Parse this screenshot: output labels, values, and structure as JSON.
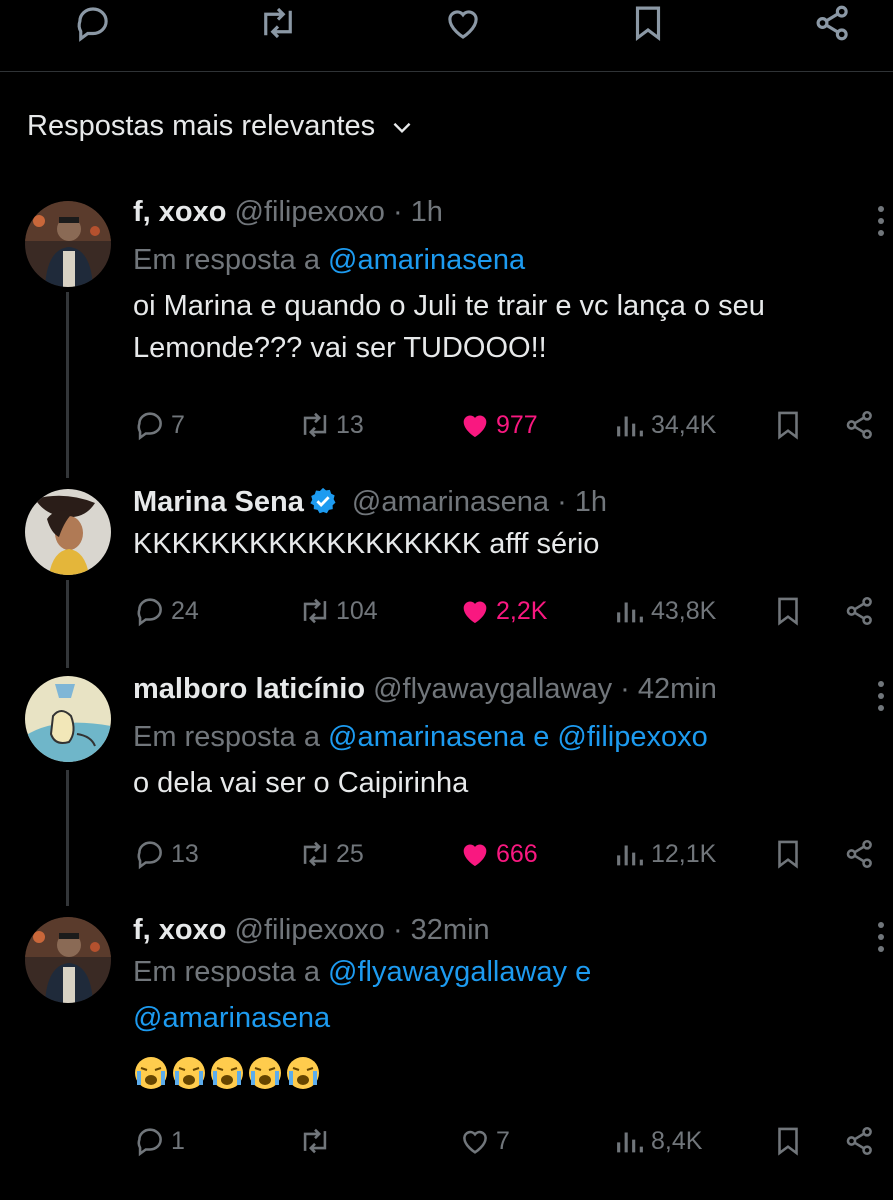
{
  "top_actions": [
    "reply-icon",
    "retweet-icon",
    "heart-icon",
    "bookmark-icon",
    "share-icon"
  ],
  "sort_label": "Respostas mais relevantes",
  "colors": {
    "background": "#000000",
    "text": "#e7e9ea",
    "muted": "#71767b",
    "link": "#1d9bf0",
    "like": "#f91880"
  },
  "tweets": [
    {
      "name": "f, xoxo",
      "handle": "@filipexoxo",
      "time": "· 1h",
      "reply_prefix": "Em resposta a",
      "reply_mention": "@amarinasena",
      "text": "oi Marina e quando o Juli te trair e vc lança o seu Lemonde??? vai ser TUDOOO!!",
      "replies": "7",
      "retweets": "13",
      "likes": "977",
      "views": "34,4K"
    },
    {
      "name": "Marina Sena",
      "handle": "@amarinasena",
      "time": "· 1h",
      "text": "KKKKKKKKKKKKKKKKKK afff sério",
      "replies": "24",
      "retweets": "104",
      "likes": "2,2K",
      "views": "43,8K"
    },
    {
      "name": "malboro laticínio",
      "handle": "@flyawaygallaway",
      "time": "· 42min",
      "reply_prefix": "Em resposta a",
      "reply_mention": "@amarinasena e @filipexoxo",
      "text": "o dela vai ser o Caipirinha",
      "replies": "13",
      "retweets": "25",
      "likes": "666",
      "views": "12,1K"
    },
    {
      "name": "f, xoxo",
      "handle": "@filipexoxo",
      "time": "· 32min",
      "reply_prefix": "Em resposta a",
      "reply_mention_1": "@flyawaygallaway e",
      "reply_mention_2": "@amarinasena",
      "emoji": "loudly-crying-face ×5",
      "replies": "1",
      "retweets": "",
      "likes": "7",
      "views": "8,4K"
    }
  ]
}
